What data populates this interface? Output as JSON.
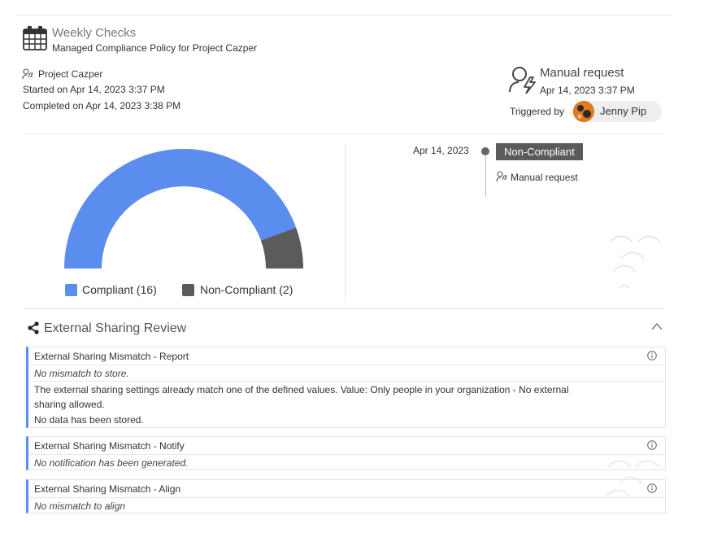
{
  "header": {
    "title": "Weekly Checks",
    "policy": "Managed Compliance Policy for Project Cazper",
    "project": "Project Cazper",
    "started": "Started on Apr 14, 2023 3:37 PM",
    "completed": "Completed on Apr 14, 2023 3:38 PM"
  },
  "request": {
    "title": "Manual request",
    "timestamp": "Apr 14, 2023 3:37 PM",
    "triggered_by_label": "Triggered by",
    "user": "Jenny Pip"
  },
  "timeline": {
    "date": "Apr 14, 2023",
    "status": "Non-Compliant",
    "source": "Manual request",
    "status_color": "#5b5b5b"
  },
  "chart_data": {
    "type": "pie",
    "variant": "semi-donut",
    "categories": [
      "Compliant",
      "Non-Compliant"
    ],
    "values": [
      16,
      2
    ],
    "colors": [
      "#5b8def",
      "#5b5b5b"
    ],
    "legend": [
      "Compliant (16)",
      "Non-Compliant (2)"
    ],
    "legend_position": "bottom"
  },
  "section": {
    "title": "External Sharing Review",
    "collapse_icon": "chevron-up-icon"
  },
  "cards": [
    {
      "title": "External Sharing Mismatch - Report",
      "status": "No mismatch to store.",
      "detail_line1": "The external sharing settings already match one of the defined values. Value: Only people in your organization - No external",
      "detail_line2": "sharing allowed.",
      "detail_line3": "No data has been stored."
    },
    {
      "title": "External Sharing Mismatch - Notify",
      "status": "No notification has been generated."
    },
    {
      "title": "External Sharing Mismatch - Align",
      "status": "No mismatch to align"
    }
  ]
}
